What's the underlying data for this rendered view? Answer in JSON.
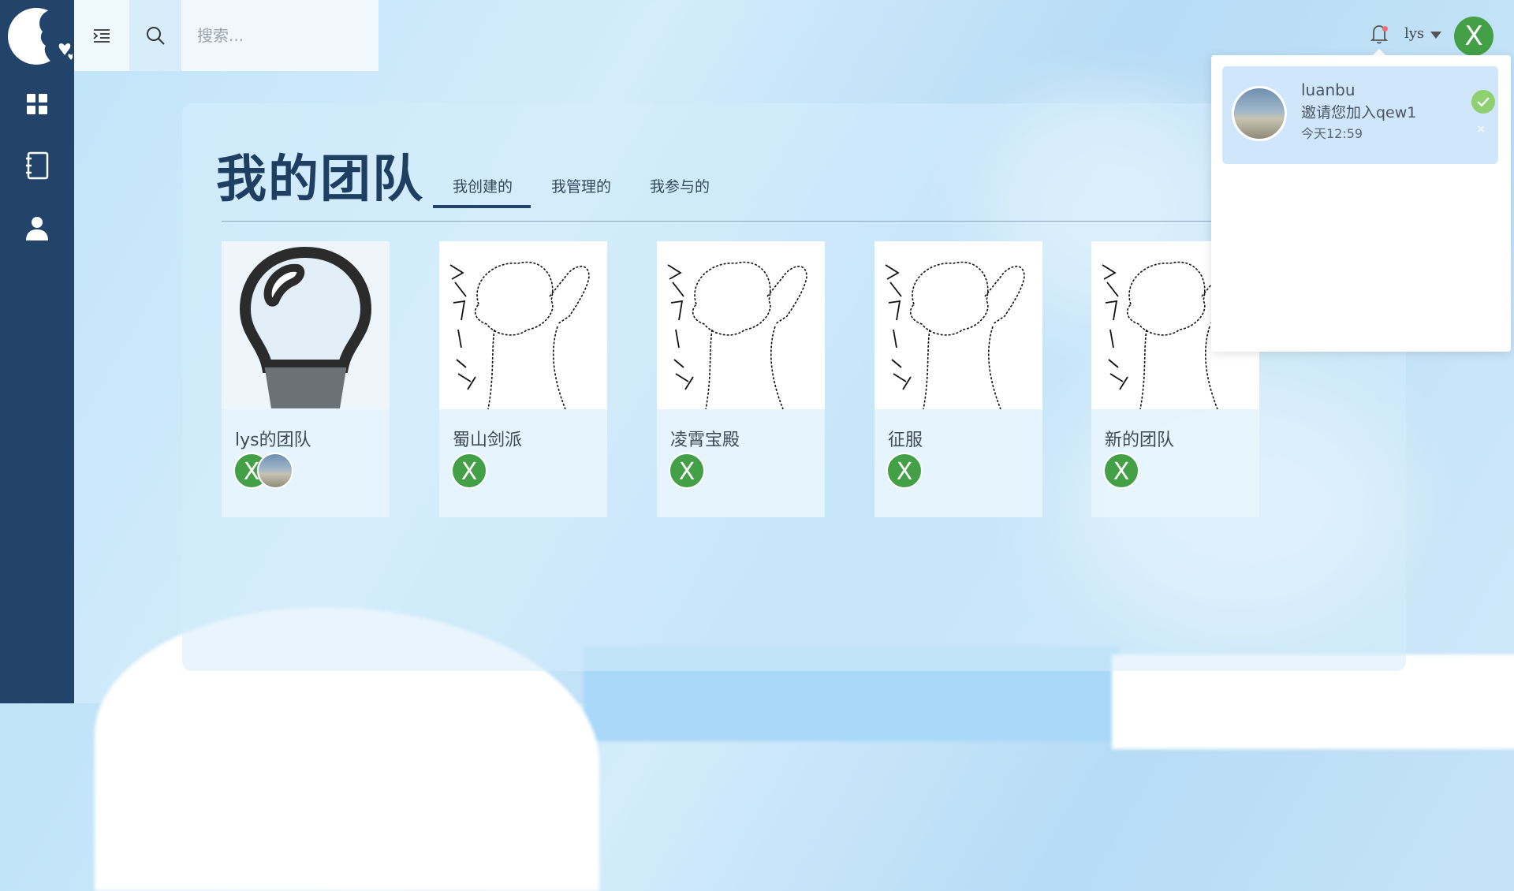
{
  "header": {
    "search_placeholder": "搜索...",
    "user_name": "lys",
    "avatar_letter": "X"
  },
  "sidebar": {
    "items": [
      {
        "icon": "dashboard-icon"
      },
      {
        "icon": "notebook-icon"
      },
      {
        "icon": "user-icon"
      }
    ]
  },
  "notification": {
    "from": "luanbu",
    "message": "邀请您加入qew1",
    "time": "今天12:59",
    "reject_symbol": "×"
  },
  "main": {
    "title": "我的团队",
    "tabs": [
      {
        "label": "我创建的",
        "active": true
      },
      {
        "label": "我管理的",
        "active": false
      },
      {
        "label": "我参与的",
        "active": false
      }
    ],
    "teams": [
      {
        "name": "lys的团队",
        "image": "lightbulb",
        "members": [
          "X",
          "photo"
        ]
      },
      {
        "name": "蜀山剑派",
        "image": "sketch",
        "members": [
          "X"
        ]
      },
      {
        "name": "凌霄宝殿",
        "image": "sketch",
        "members": [
          "X"
        ]
      },
      {
        "name": "征服",
        "image": "sketch",
        "members": [
          "X"
        ]
      },
      {
        "name": "新的团队",
        "image": "sketch",
        "members": [
          "X"
        ]
      }
    ]
  },
  "colors": {
    "sidebar": "#23446a",
    "avatar_green": "#43a047",
    "accept_green": "#8fd170",
    "notif_dot": "#f56c6c"
  }
}
